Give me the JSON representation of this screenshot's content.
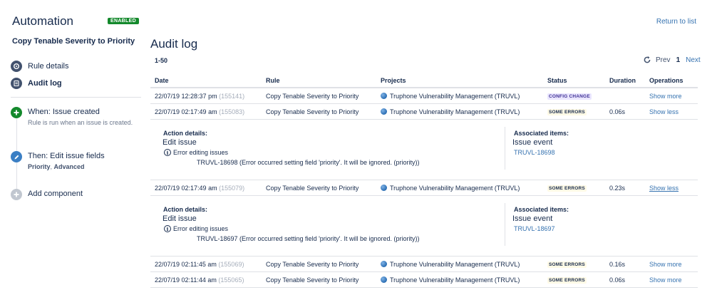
{
  "sidebar": {
    "title": "Automation",
    "badge": "ENABLED",
    "rule_name": "Copy Tenable Severity to Priority",
    "nav": [
      {
        "label": "Rule details"
      },
      {
        "label": "Audit log"
      }
    ],
    "components": [
      {
        "title": "When: Issue created",
        "subtitle": "Rule is run when an issue is created.",
        "color": "#14892c",
        "icon": "plus-icon"
      },
      {
        "title": "Then: Edit issue fields",
        "subtitle_bold_1": "Priority",
        "subtitle_sep": ", ",
        "subtitle_bold_2": "Advanced",
        "color": "#3b7fc4",
        "icon": "pencil-icon"
      },
      {
        "title": "Add component",
        "color": "#c1c7d0",
        "icon": "plus-icon"
      }
    ]
  },
  "main": {
    "return_link": "Return to list",
    "heading": "Audit log",
    "range": "1-50",
    "pager": {
      "prev": "Prev",
      "current": "1",
      "next": "Next"
    },
    "columns": [
      "Date",
      "Rule",
      "Projects",
      "Status",
      "Duration",
      "Operations"
    ],
    "rows": [
      {
        "date": "22/07/19 12:28:37 pm",
        "id": "(155141)",
        "rule": "Copy Tenable Severity to Priority",
        "project": "Truphone Vulnerability Management (TRUVL)",
        "status": "CONFIG CHANGE",
        "duration": "",
        "op": "Show more"
      },
      {
        "date": "22/07/19 02:17:49 am",
        "id": "(155083)",
        "rule": "Copy Tenable Severity to Priority",
        "project": "Truphone Vulnerability Management (TRUVL)",
        "status": "SOME ERRORS",
        "duration": "0.06s",
        "op": "Show less"
      },
      {
        "date": "22/07/19 02:17:49 am",
        "id": "(155079)",
        "rule": "Copy Tenable Severity to Priority",
        "project": "Truphone Vulnerability Management (TRUVL)",
        "status": "SOME ERRORS",
        "duration": "0.23s",
        "op": "Show less"
      },
      {
        "date": "22/07/19 02:11:45 am",
        "id": "(155069)",
        "rule": "Copy Tenable Severity to Priority",
        "project": "Truphone Vulnerability Management (TRUVL)",
        "status": "SOME ERRORS",
        "duration": "0.16s",
        "op": "Show more"
      },
      {
        "date": "22/07/19 02:11:44 am",
        "id": "(155065)",
        "rule": "Copy Tenable Severity to Priority",
        "project": "Truphone Vulnerability Management (TRUVL)",
        "status": "SOME ERRORS",
        "duration": "0.06s",
        "op": "Show more"
      }
    ],
    "details": [
      {
        "action_title": "Action details:",
        "action": "Edit issue",
        "error_label": "Error editing issues",
        "error_msg": "TRUVL-18698 (Error occurred setting field 'priority'. It will be ignored. (priority))",
        "assoc_title": "Associated items:",
        "assoc": "Issue event",
        "assoc_link": "TRUVL-18698"
      },
      {
        "action_title": "Action details:",
        "action": "Edit issue",
        "error_label": "Error editing issues",
        "error_msg": "TRUVL-18697 (Error occurred setting field 'priority'. It will be ignored. (priority))",
        "assoc_title": "Associated items:",
        "assoc": "Issue event",
        "assoc_link": "TRUVL-18697"
      }
    ]
  }
}
